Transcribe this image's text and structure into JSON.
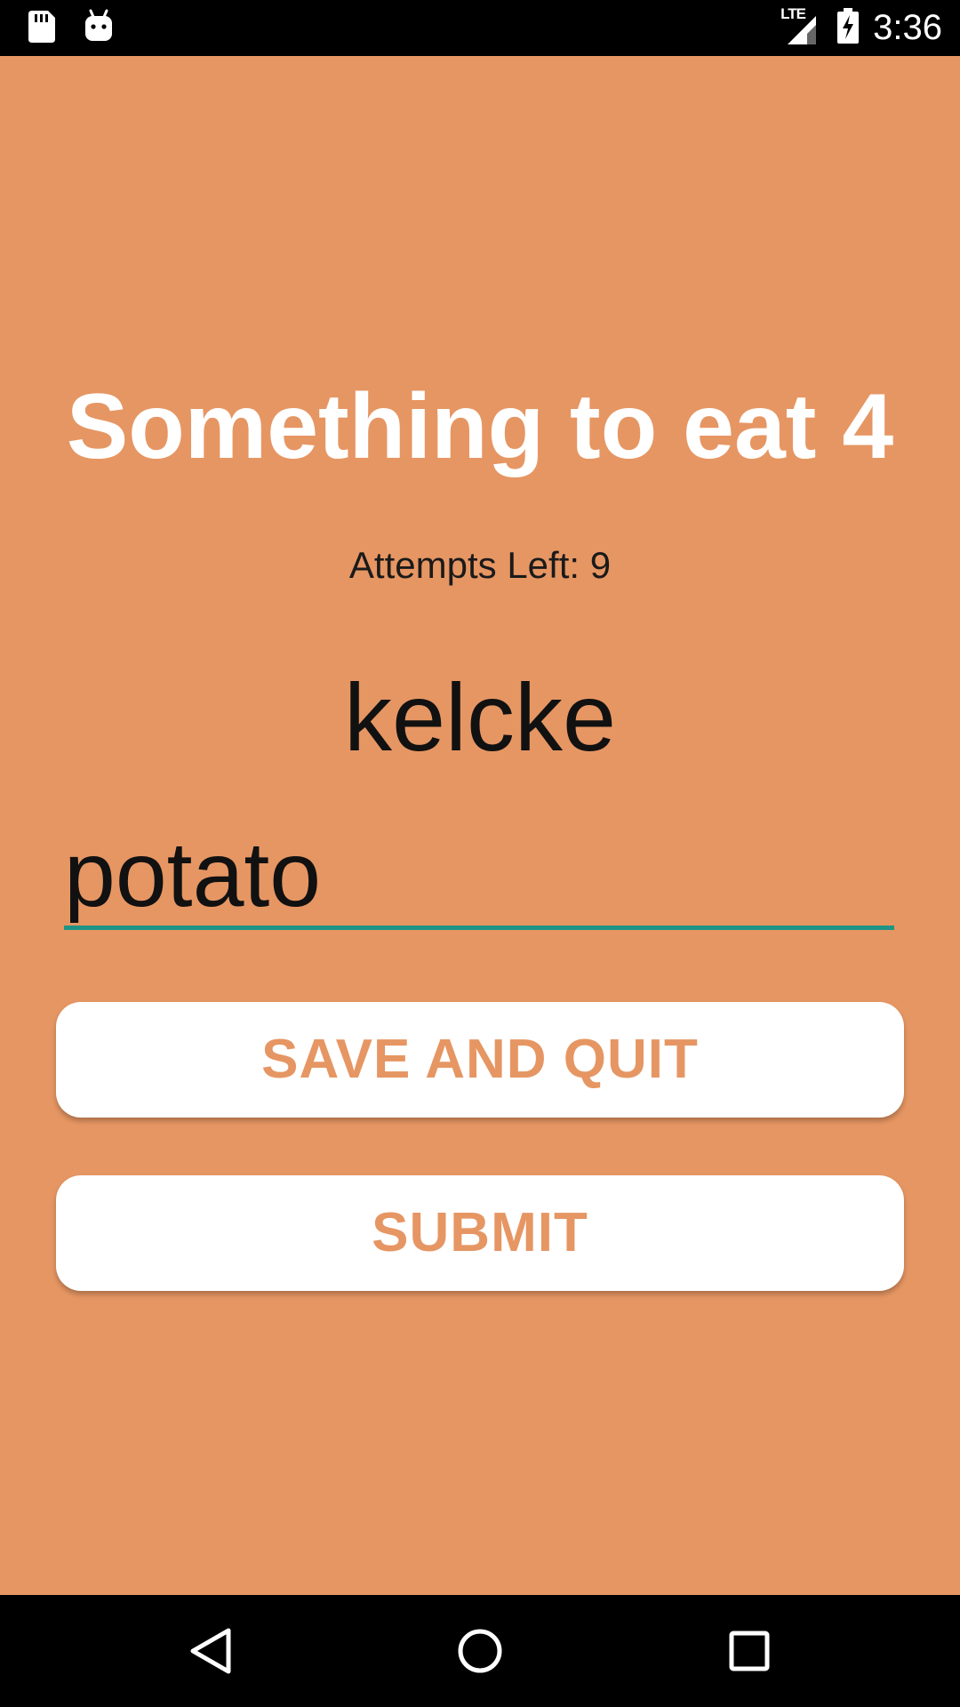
{
  "status_bar": {
    "time": "3:36",
    "network": "LTE",
    "icons": [
      "sd-card-icon",
      "android-icon",
      "signal-icon",
      "battery-charging-icon"
    ]
  },
  "game": {
    "title": "Something to eat 4",
    "attempts_label": "Attempts Left: 9",
    "scrambled_word": "kelcke",
    "guess_input_value": "potato"
  },
  "buttons": {
    "save_quit_label": "SAVE AND QUIT",
    "submit_label": "SUBMIT"
  },
  "nav_bar": {
    "icons": [
      "back-icon",
      "home-icon",
      "recents-icon"
    ]
  },
  "colors": {
    "background": "#e69663",
    "accent_underline": "#1f9486",
    "button_text": "#e69663",
    "button_bg": "#ffffff"
  }
}
